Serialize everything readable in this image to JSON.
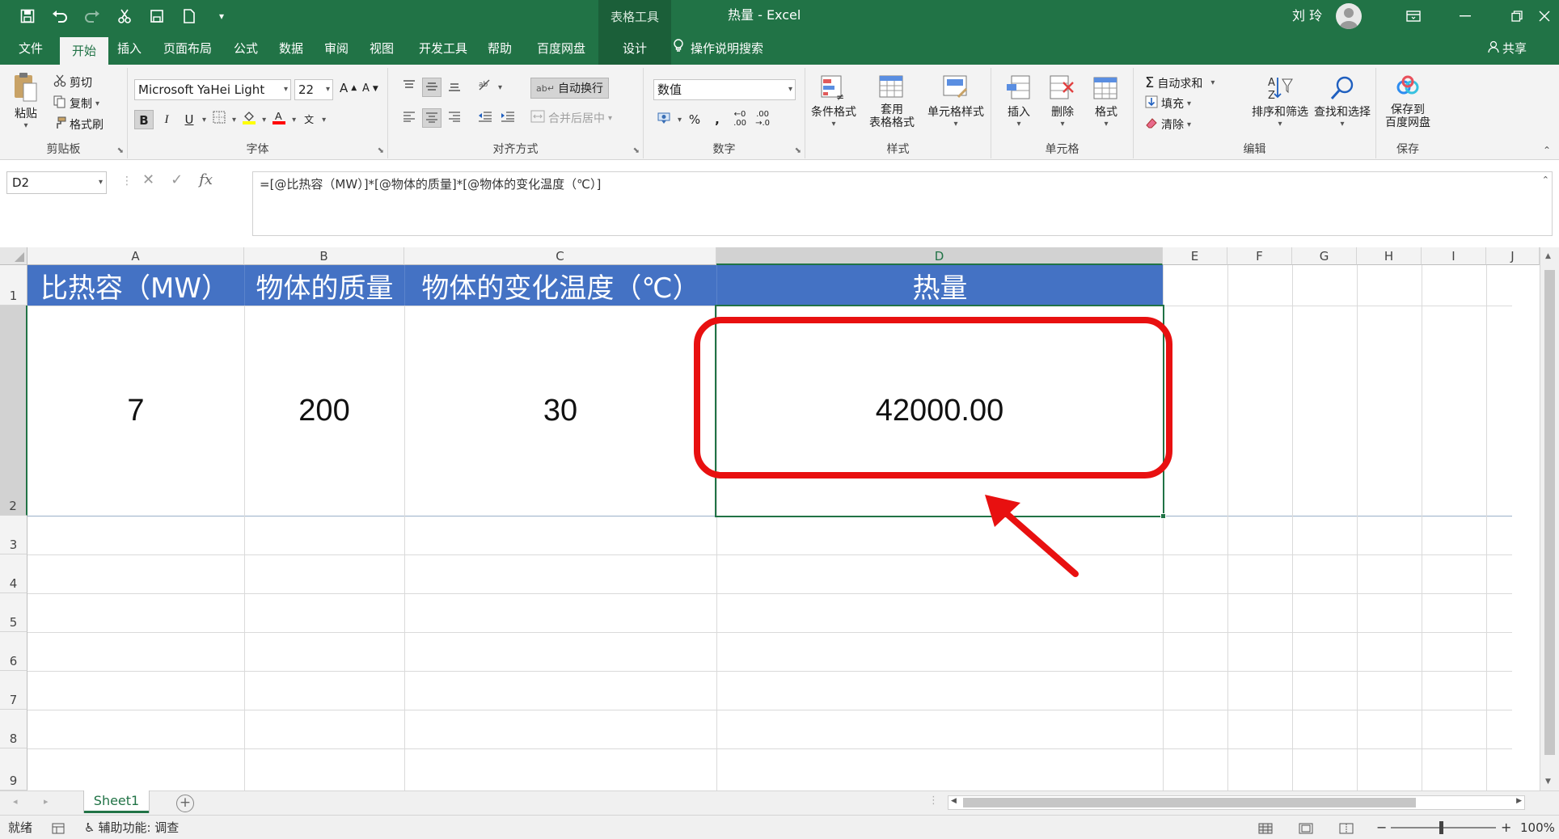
{
  "title_bar": {
    "window_title": "热量  -  Excel",
    "context_tab": "表格工具",
    "user_name": "刘 玲"
  },
  "ribbon_tabs": [
    "文件",
    "开始",
    "插入",
    "页面布局",
    "公式",
    "数据",
    "审阅",
    "视图",
    "开发工具",
    "帮助",
    "百度网盘",
    "设计"
  ],
  "active_tab": "开始",
  "tell_me": "操作说明搜索",
  "share": "共享",
  "ribbon": {
    "clipboard": {
      "label": "剪贴板",
      "paste": "粘贴",
      "cut": "剪切",
      "copy": "复制",
      "format_painter": "格式刷"
    },
    "font": {
      "label": "字体",
      "font_name": "Microsoft YaHei Light",
      "font_size": "22",
      "bold": "B",
      "italic": "I",
      "underline": "U"
    },
    "alignment": {
      "label": "对齐方式",
      "wrap_text": "自动换行",
      "merge_center": "合并后居中"
    },
    "number": {
      "label": "数字",
      "format": "数值",
      "percent": "%",
      "comma": ","
    },
    "styles": {
      "label": "样式",
      "conditional": "条件格式",
      "table_format_1": "套用",
      "table_format_2": "表格格式",
      "cell_styles": "单元格样式"
    },
    "cells": {
      "label": "单元格",
      "insert": "插入",
      "delete": "删除",
      "format": "格式"
    },
    "editing": {
      "label": "编辑",
      "autosum": "自动求和",
      "fill": "填充",
      "clear": "清除",
      "sort_filter": "排序和筛选",
      "find_select": "查找和选择"
    },
    "save": {
      "label": "保存",
      "save_to_1": "保存到",
      "save_to_2": "百度网盘"
    }
  },
  "formula_bar": {
    "name_box": "D2",
    "formula": "=[@比热容（MW）]*[@物体的质量]*[@物体的变化温度（℃）]"
  },
  "grid": {
    "columns": [
      "A",
      "B",
      "C",
      "D",
      "E",
      "F",
      "G",
      "H",
      "I",
      "J"
    ],
    "rows": [
      "1",
      "2",
      "3",
      "4",
      "5",
      "6",
      "7",
      "8",
      "9"
    ],
    "headers": [
      "比热容（MW）",
      "物体的质量",
      "物体的变化温度（℃）",
      "热量"
    ],
    "values": [
      "7",
      "200",
      "30",
      "42000.00"
    ],
    "selected_cell": "D2"
  },
  "sheet_tabs": [
    "Sheet1"
  ],
  "status_bar": {
    "ready": "就绪",
    "accessibility": "辅助功能: 调查",
    "zoom": "100%"
  },
  "colors": {
    "excel_green": "#217346",
    "header_fill": "#4472c4",
    "annotation_red": "#e81010"
  }
}
